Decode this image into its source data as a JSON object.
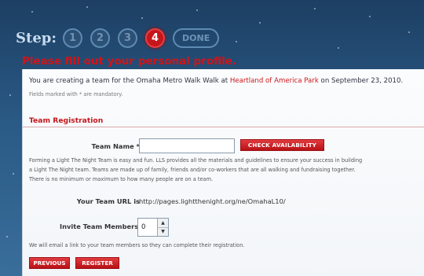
{
  "steps": {
    "label": "Step:",
    "items": [
      "1",
      "2",
      "3",
      "4"
    ],
    "done_label": "DONE",
    "active": "4"
  },
  "title": "Please fill out your personal profile.",
  "intro": {
    "prefix": "You are creating a team for the Omaha Metro Walk Walk at ",
    "link": "Heartland of America Park",
    "suffix": " on September 23, 2010."
  },
  "mandatory_note": "Fields marked with * are mandatory.",
  "section": {
    "heading": "Team Registration"
  },
  "team_name": {
    "label": "Team Name *",
    "value": "",
    "check_button": "CHECK AVAILABILITY"
  },
  "description": "Forming a Light The Night Team is easy and fun. LLS provides all the materials and guidelines to ensure your success in building a Light The Night team. Teams are made up of family, friends and/or co-workers that are all walking and fundraising together. There is no minimum or maximum to how many people are on a team.",
  "team_url": {
    "label": "Your Team URL is",
    "value": "http://pages.lightthenight.org/ne/OmahaL10/"
  },
  "invite": {
    "label": "Invite Team Members",
    "value": "0"
  },
  "email_note": "We will email a link to your team members so they can complete their registration.",
  "buttons": {
    "previous": "PREVIOUS",
    "register": "REGISTER"
  },
  "colors": {
    "accent_red": "#c6161b",
    "background_blue": "#2a5a86"
  }
}
